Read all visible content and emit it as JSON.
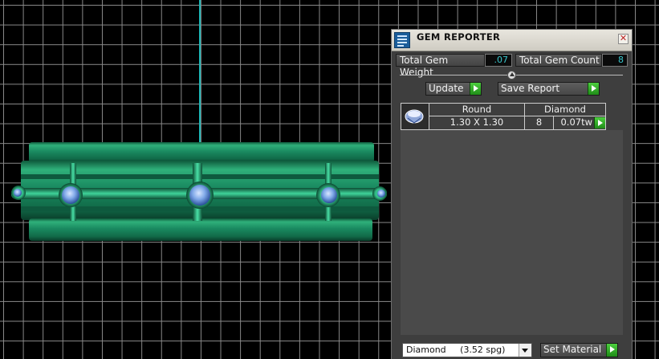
{
  "panel": {
    "title": "GEM REPORTER",
    "close_icon": "✕",
    "total_gem_weight_label": "Total Gem Weight",
    "total_gem_weight_value": ".07",
    "total_gem_count_label": "Total Gem Count",
    "total_gem_count_value": "8",
    "update_label": "Update",
    "save_report_label": "Save Report",
    "table": {
      "headers": [
        "Round",
        "Diamond"
      ],
      "row": {
        "size": "1.30 X 1.30",
        "count": "8",
        "weight": "0.07tw"
      }
    },
    "material_select_value": "Diamond     (3.52 spg)",
    "set_material_label": "Set Material"
  },
  "colors": {
    "ring_green": "#1a8a60",
    "gem_blue": "#7fa8e8",
    "value_text": "#39c6cc",
    "play_green": "#3bb830"
  }
}
